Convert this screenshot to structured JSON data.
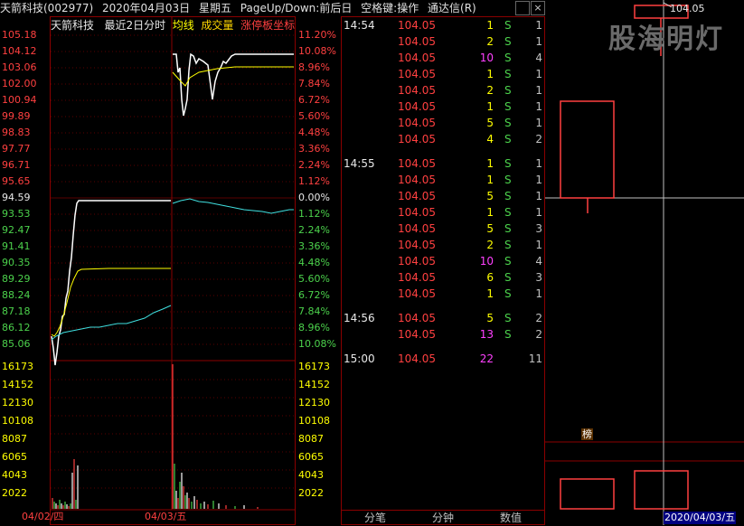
{
  "title": {
    "stock": "天箭科技(002977)",
    "date": "2020年04月03日",
    "weekday": "星期五",
    "hint1": "PageUp/Down:前后日",
    "hint2": "空格键:操作",
    "app": "通达信(R)"
  },
  "chart_header": {
    "name": "天箭科技",
    "period": "最近2日分时",
    "avg_label": "均线",
    "vol_label": "成交量",
    "limit_label": "涨停板坐标"
  },
  "price_axis_left": [
    "105.18",
    "104.12",
    "103.06",
    "102.00",
    "100.94",
    "99.89",
    "98.83",
    "97.77",
    "96.71",
    "95.65",
    "94.59",
    "93.53",
    "92.47",
    "91.41",
    "90.35",
    "89.29",
    "88.24",
    "87.18",
    "86.12",
    "85.06"
  ],
  "pct_axis_right": [
    "11.20%",
    "10.08%",
    "8.96%",
    "7.84%",
    "6.72%",
    "5.60%",
    "4.48%",
    "3.36%",
    "2.24%",
    "1.12%",
    "0.00%",
    "1.12%",
    "2.24%",
    "3.36%",
    "4.48%",
    "5.60%",
    "6.72%",
    "7.84%",
    "8.96%",
    "10.08%"
  ],
  "volume_axis": [
    "16173",
    "14152",
    "12130",
    "10108",
    "8087",
    "6065",
    "4043",
    "2022"
  ],
  "x_labels": [
    "04/02/四",
    "04/03/五"
  ],
  "ticks": [
    {
      "time": "14:54",
      "price": "104.05",
      "vol": "1",
      "side": "S",
      "n": "1"
    },
    {
      "time": "",
      "price": "104.05",
      "vol": "2",
      "side": "S",
      "n": "1"
    },
    {
      "time": "",
      "price": "104.05",
      "vol": "10",
      "side": "S",
      "n": "4"
    },
    {
      "time": "",
      "price": "104.05",
      "vol": "1",
      "side": "S",
      "n": "1"
    },
    {
      "time": "",
      "price": "104.05",
      "vol": "2",
      "side": "S",
      "n": "1"
    },
    {
      "time": "",
      "price": "104.05",
      "vol": "1",
      "side": "S",
      "n": "1"
    },
    {
      "time": "",
      "price": "104.05",
      "vol": "5",
      "side": "S",
      "n": "1"
    },
    {
      "time": "",
      "price": "104.05",
      "vol": "4",
      "side": "S",
      "n": "2"
    },
    {
      "time": "14:55",
      "price": "104.05",
      "vol": "1",
      "side": "S",
      "n": "1"
    },
    {
      "time": "",
      "price": "104.05",
      "vol": "1",
      "side": "S",
      "n": "1"
    },
    {
      "time": "",
      "price": "104.05",
      "vol": "5",
      "side": "S",
      "n": "1"
    },
    {
      "time": "",
      "price": "104.05",
      "vol": "1",
      "side": "S",
      "n": "1"
    },
    {
      "time": "",
      "price": "104.05",
      "vol": "5",
      "side": "S",
      "n": "3"
    },
    {
      "time": "",
      "price": "104.05",
      "vol": "2",
      "side": "S",
      "n": "1"
    },
    {
      "time": "",
      "price": "104.05",
      "vol": "10",
      "side": "S",
      "n": "4"
    },
    {
      "time": "",
      "price": "104.05",
      "vol": "6",
      "side": "S",
      "n": "3"
    },
    {
      "time": "",
      "price": "104.05",
      "vol": "1",
      "side": "S",
      "n": "1"
    },
    {
      "time": "14:56",
      "price": "104.05",
      "vol": "5",
      "side": "S",
      "n": "2"
    },
    {
      "time": "",
      "price": "104.05",
      "vol": "13",
      "side": "S",
      "n": "2"
    },
    {
      "time": "15:00",
      "price": "104.05",
      "vol": "22",
      "side": "",
      "n": "11"
    }
  ],
  "tabs": [
    "分笔",
    "分钟",
    "数值"
  ],
  "kline": {
    "last_price": "104.05",
    "date_label": "2020/04/03/五",
    "marker": "榜",
    "watermark": "股海明灯"
  },
  "colors": {
    "up": "#ff4040",
    "down": "#4cd24c",
    "frame": "#8b0000",
    "price_line": "#ffffff",
    "avg_line": "#ffff00"
  }
}
